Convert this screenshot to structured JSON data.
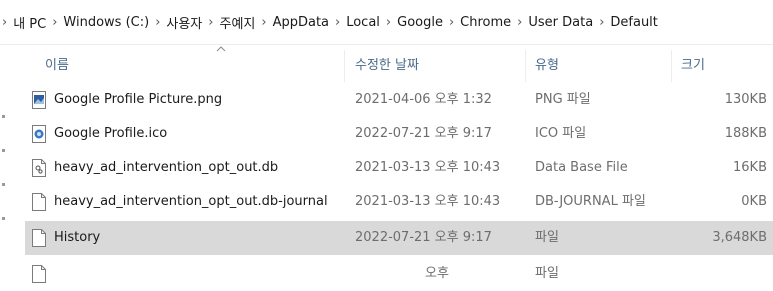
{
  "breadcrumb": [
    "내 PC",
    "Windows (C:)",
    "사용자",
    "주예지",
    "AppData",
    "Local",
    "Google",
    "Chrome",
    "User Data",
    "Default"
  ],
  "columns": {
    "name": "이름",
    "date": "수정한 날짜",
    "type": "유형",
    "size": "크기"
  },
  "files": [
    {
      "name": "Google Profile Picture.png",
      "date": "2021-04-06 오후 1:32",
      "type": "PNG 파일",
      "size": "130KB",
      "icon": "image-file-icon",
      "selected": false
    },
    {
      "name": "Google Profile.ico",
      "date": "2022-07-21 오후 9:17",
      "type": "ICO 파일",
      "size": "188KB",
      "icon": "ico-file-icon",
      "selected": false
    },
    {
      "name": "heavy_ad_intervention_opt_out.db",
      "date": "2021-03-13 오후 10:43",
      "type": "Data Base File",
      "size": "16KB",
      "icon": "database-file-icon",
      "selected": false
    },
    {
      "name": "heavy_ad_intervention_opt_out.db-journal",
      "date": "2021-03-13 오후 10:43",
      "type": "DB-JOURNAL 파일",
      "size": "0KB",
      "icon": "blank-file-icon",
      "selected": false
    },
    {
      "name": "History",
      "date": "2022-07-21 오후 9:17",
      "type": "파일",
      "size": "3,648KB",
      "icon": "blank-file-icon",
      "selected": true
    },
    {
      "name": "",
      "date": "오후",
      "type": "파일",
      "size": "",
      "icon": "blank-file-icon",
      "selected": false
    }
  ]
}
